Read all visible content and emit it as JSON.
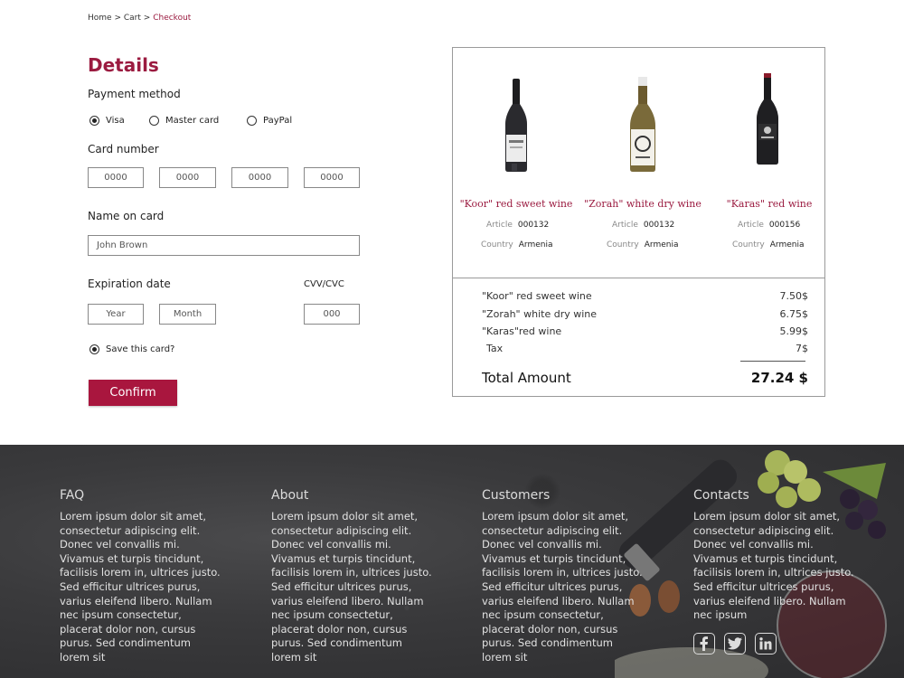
{
  "breadcrumb": {
    "items": [
      "Home",
      "Cart"
    ],
    "separator": ">",
    "current": "Checkout"
  },
  "form": {
    "title": "Details",
    "payment_label": "Payment method",
    "payment_options": [
      {
        "label": "Visa",
        "selected": true
      },
      {
        "label": "Master card",
        "selected": false
      },
      {
        "label": "PayPal",
        "selected": false
      }
    ],
    "card_number_label": "Card number",
    "card_number_placeholders": [
      "0000",
      "0000",
      "0000",
      "0000"
    ],
    "name_label": "Name on card",
    "name_value": "John Brown",
    "expiration_label": "Expiration date",
    "year_placeholder": "Year",
    "month_placeholder": "Month",
    "cvv_label": "CVV/CVC",
    "cvv_placeholder": "000",
    "save_card_label": "Save this card?",
    "save_card_checked": true,
    "confirm_label": "Confirm"
  },
  "summary": {
    "products": [
      {
        "name": "\"Koor\" red sweet wine",
        "article_label": "Article",
        "article": "000132",
        "country_label": "Country",
        "country": "Armenia"
      },
      {
        "name": "\"Zorah\" white dry wine",
        "article_label": "Article",
        "article": "000132",
        "country_label": "Country",
        "country": "Armenia"
      },
      {
        "name": "\"Karas\" red wine",
        "article_label": "Article",
        "article": "000156",
        "country_label": "Country",
        "country": "Armenia"
      }
    ],
    "lines": [
      {
        "label": "\"Koor\" red sweet wine",
        "price": "7.50$"
      },
      {
        "label": "\"Zorah\" white dry wine",
        "price": "6.75$"
      },
      {
        "label": "\"Karas\"red wine",
        "price": "5.99$"
      },
      {
        "label": "Tax",
        "price": "7$"
      }
    ],
    "total_label": "Total Amount",
    "total_value": "27.24 $"
  },
  "footer": {
    "columns": [
      {
        "title": "FAQ",
        "text": "Lorem ipsum dolor sit amet, consectetur adipiscing elit. Donec vel convallis mi. Vivamus et turpis tincidunt, facilisis lorem in, ultrices justo. Sed efficitur ultrices purus, varius eleifend libero. Nullam nec ipsum consectetur, placerat dolor non, cursus purus. Sed condimentum lorem sit"
      },
      {
        "title": "About",
        "text": "Lorem ipsum dolor sit amet, consectetur adipiscing elit. Donec vel convallis mi. Vivamus et turpis tincidunt, facilisis lorem in, ultrices justo. Sed efficitur ultrices purus, varius eleifend libero. Nullam nec ipsum consectetur, placerat dolor non, cursus purus. Sed condimentum lorem sit"
      },
      {
        "title": "Customers",
        "text": "Lorem ipsum dolor sit amet, consectetur adipiscing elit. Donec vel convallis mi. Vivamus et turpis tincidunt, facilisis lorem in, ultrices justo. Sed efficitur ultrices purus, varius eleifend libero. Nullam nec ipsum consectetur, placerat dolor non, cursus purus. Sed condimentum lorem sit"
      },
      {
        "title": "Contacts",
        "text": "Lorem ipsum dolor sit amet, consectetur adipiscing elit. Donec vel convallis mi. Vivamus et turpis tincidunt, facilisis lorem in, ultrices justo. Sed efficitur ultrices purus, varius eleifend libero. Nullam nec ipsum"
      }
    ],
    "social_icons": [
      "facebook-icon",
      "twitter-icon",
      "linkedin-icon"
    ]
  },
  "colors": {
    "accent": "#9b1b40",
    "button": "#a9163e",
    "footer_bg": "#333335"
  }
}
